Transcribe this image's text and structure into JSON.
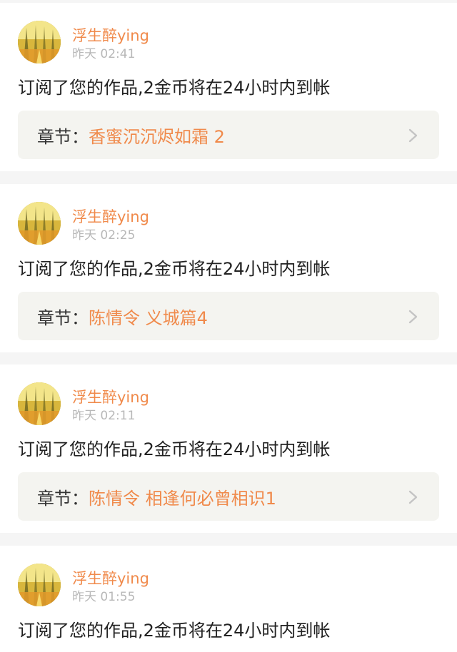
{
  "colors": {
    "accent": "#f08a4b",
    "text_primary": "#222222",
    "text_secondary": "#b8b8b8",
    "chapter_bg": "#f4f4f0",
    "page_bg": "#f5f5f5"
  },
  "feed": {
    "items": [
      {
        "username": "浮生醉ying",
        "time": "昨天 02:41",
        "message": "订阅了您的作品,2金币将在24小时内到帐",
        "chapter_prefix": "章节：",
        "chapter_title": "香蜜沉沉烬如霜 2",
        "avatar_icon": "avatar-image",
        "chevron_icon": "chevron-right-icon"
      },
      {
        "username": "浮生醉ying",
        "time": "昨天 02:25",
        "message": "订阅了您的作品,2金币将在24小时内到帐",
        "chapter_prefix": "章节：",
        "chapter_title": "陈情令 义城篇4",
        "avatar_icon": "avatar-image",
        "chevron_icon": "chevron-right-icon"
      },
      {
        "username": "浮生醉ying",
        "time": "昨天 02:11",
        "message": "订阅了您的作品,2金币将在24小时内到帐",
        "chapter_prefix": "章节：",
        "chapter_title": "陈情令 相逢何必曾相识1",
        "avatar_icon": "avatar-image",
        "chevron_icon": "chevron-right-icon"
      },
      {
        "username": "浮生醉ying",
        "time": "昨天 01:55",
        "message": "订阅了您的作品,2金币将在24小时内到帐",
        "avatar_icon": "avatar-image"
      }
    ]
  }
}
